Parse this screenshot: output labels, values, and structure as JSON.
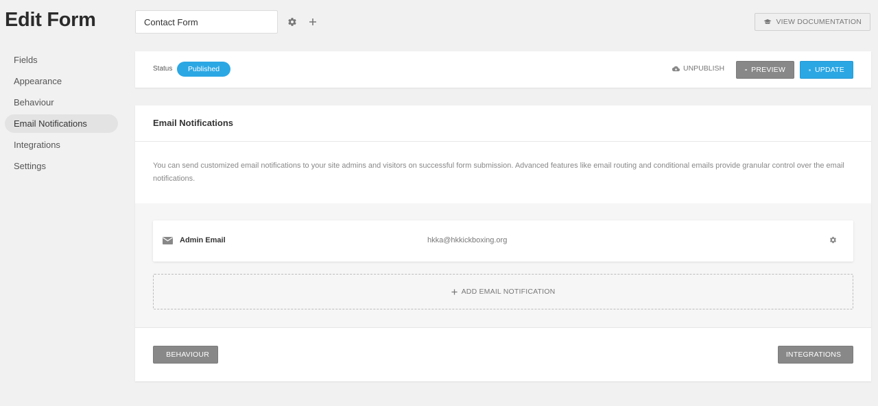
{
  "page": {
    "title": "Edit Form"
  },
  "sidebar": {
    "items": [
      {
        "label": "Fields",
        "active": false
      },
      {
        "label": "Appearance",
        "active": false
      },
      {
        "label": "Behaviour",
        "active": false
      },
      {
        "label": "Email Notifications",
        "active": true
      },
      {
        "label": "Integrations",
        "active": false
      },
      {
        "label": "Settings",
        "active": false
      }
    ]
  },
  "header": {
    "form_name": "Contact Form",
    "settings_icon": "gear-icon",
    "add_icon": "plus-icon",
    "view_docs_label": "VIEW DOCUMENTATION"
  },
  "status_bar": {
    "status_label": "Status",
    "status_value": "Published",
    "unpublish_label": "UNPUBLISH",
    "preview_label": "PREVIEW",
    "update_label": "UPDATE"
  },
  "notifications": {
    "title": "Email Notifications",
    "description": "You can send customized email notifications to your site admins and visitors on successful form submission. Advanced features like email routing and conditional emails provide granular control over the email notifications.",
    "items": [
      {
        "name": "Admin Email",
        "recipient": "hkka@hkkickboxing.org"
      }
    ],
    "add_label": "ADD EMAIL NOTIFICATION"
  },
  "nav": {
    "prev_label": "BEHAVIOUR",
    "next_label": "INTEGRATIONS"
  },
  "colors": {
    "accent": "#2ba7e4",
    "button_gray": "#888888",
    "background": "#f1f1f1"
  }
}
